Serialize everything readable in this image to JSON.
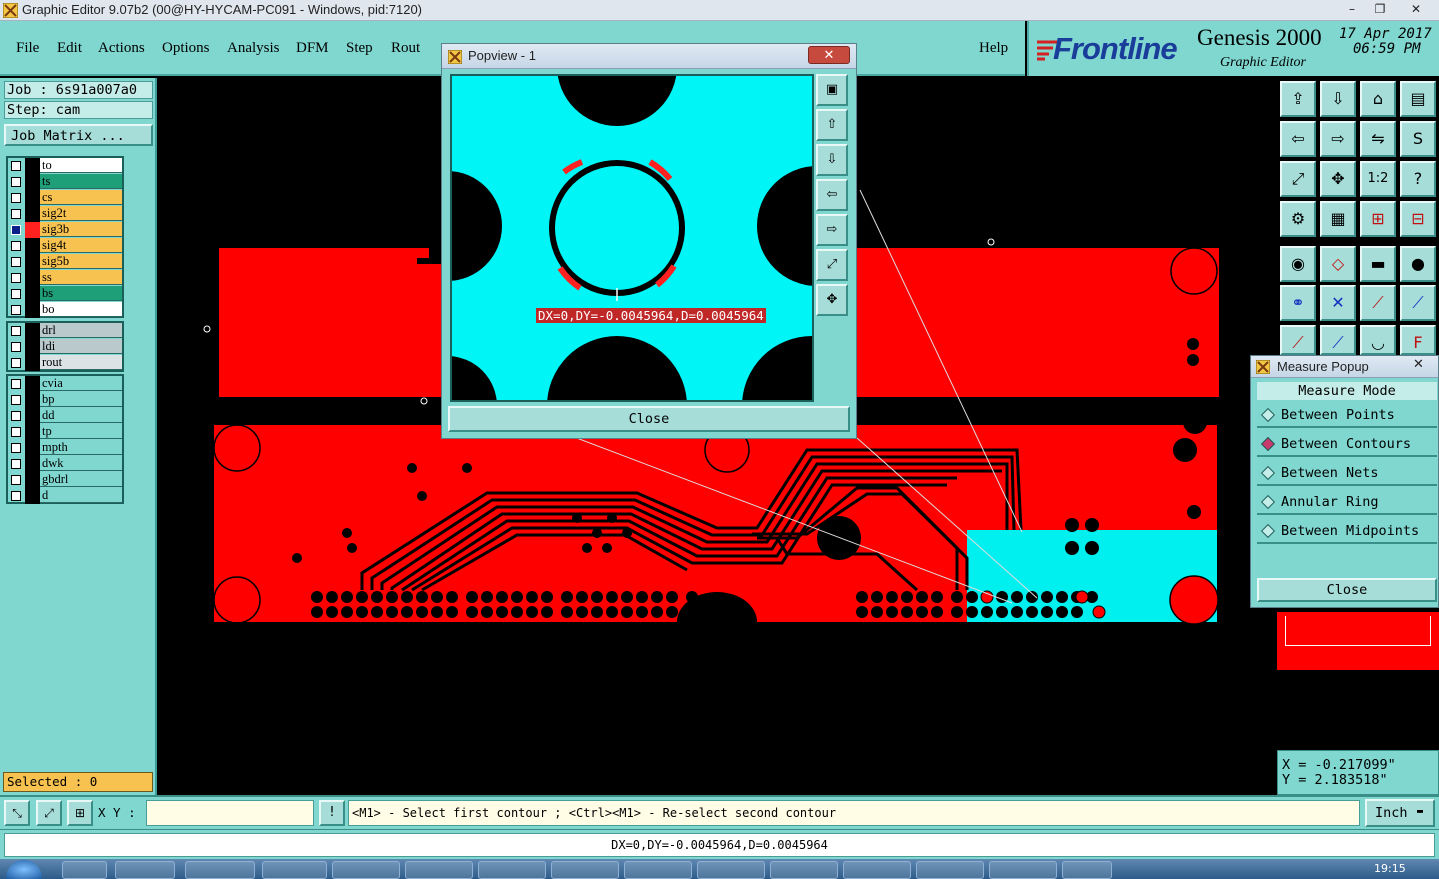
{
  "window": {
    "title": "Graphic Editor 9.07b2 (00@HY-HYCAM-PC091 - Windows, pid:7120)",
    "minimize": "–",
    "restore": "❐",
    "close": "✕"
  },
  "menu": {
    "items": [
      "File",
      "Edit",
      "Actions",
      "Options",
      "Analysis",
      "DFM",
      "Step",
      "Rout"
    ],
    "help": "Help"
  },
  "brand": {
    "logo": "Frontline",
    "product": "Genesis 2000",
    "subtitle": "Graphic Editor",
    "date": "17 Apr 2017",
    "time": "06:59 PM"
  },
  "job": {
    "job_label": "Job : 6s91a007a0",
    "step_label": "Step: cam",
    "matrix_button": "Job Matrix ..."
  },
  "layers": {
    "group1": [
      {
        "name": "to",
        "color": "#ffffff",
        "swatch": "#000000",
        "mark": "⬋"
      },
      {
        "name": "ts",
        "color": "#1f9f78",
        "swatch": "#000000",
        "mark": ""
      },
      {
        "name": "cs",
        "color": "#f7c24f",
        "swatch": "#000000",
        "mark": ""
      },
      {
        "name": "sig2t",
        "color": "#f7c24f",
        "swatch": "#000000",
        "mark": ""
      },
      {
        "name": "sig3b",
        "color": "#f7c24f",
        "swatch": "#ff2020",
        "mark": "▣",
        "active": true
      },
      {
        "name": "sig4t",
        "color": "#f7c24f",
        "swatch": "#000000",
        "mark": ""
      },
      {
        "name": "sig5b",
        "color": "#f7c24f",
        "swatch": "#000000",
        "mark": ""
      },
      {
        "name": "ss",
        "color": "#f7c24f",
        "swatch": "#000000",
        "mark": ""
      },
      {
        "name": "bs",
        "color": "#1f9f78",
        "swatch": "#000000",
        "mark": ""
      },
      {
        "name": "bo",
        "color": "#ffffff",
        "swatch": "#000000",
        "mark": "⬋"
      }
    ],
    "group2": [
      {
        "name": "drl",
        "color": "#b9c9cc"
      },
      {
        "name": "ldi",
        "color": "#b9c9cc"
      },
      {
        "name": "rout",
        "color": "#dce3e4"
      }
    ],
    "group3": [
      {
        "name": "cvia",
        "color": "#7fd7d0"
      },
      {
        "name": "bp",
        "color": "#7fd7d0"
      },
      {
        "name": "dd",
        "color": "#7fd7d0"
      },
      {
        "name": "tp",
        "color": "#7fd7d0"
      },
      {
        "name": "mpth",
        "color": "#7fd7d0"
      },
      {
        "name": "dwk",
        "color": "#7fd7d0"
      },
      {
        "name": "gbdrl",
        "color": "#7fd7d0"
      },
      {
        "name": "d",
        "color": "#7fd7d0"
      }
    ]
  },
  "selected": "Selected : 0",
  "popview": {
    "title": "Popview - 1",
    "measure_label": "DX=0,DY=-0.0045964,D=0.0045964",
    "close": "Close"
  },
  "measure_popup": {
    "title": "Measure Popup",
    "mode_label": "Measure Mode",
    "options": [
      {
        "label": "Between Points",
        "selected": false
      },
      {
        "label": "Between Contours",
        "selected": true
      },
      {
        "label": "Between Nets",
        "selected": false
      },
      {
        "label": "Annular Ring",
        "selected": false
      },
      {
        "label": "Between Midpoints",
        "selected": false
      }
    ],
    "close": "Close"
  },
  "coords": {
    "x": "X = -0.217099\"",
    "y": "Y = 2.183518\""
  },
  "command": {
    "xy_label": "X Y :",
    "xy_value": "",
    "prompt": "<M1> - Select first contour ; <Ctrl><M1> - Re-select second contour",
    "units": "Inch"
  },
  "status": "DX=0,DY=-0.0045964,D=0.0045964",
  "taskbar": {
    "clock": "19:15"
  },
  "colors": {
    "panel": "#7fd7d0",
    "copper": "#ff0000",
    "highlight": "#00f0f0"
  }
}
